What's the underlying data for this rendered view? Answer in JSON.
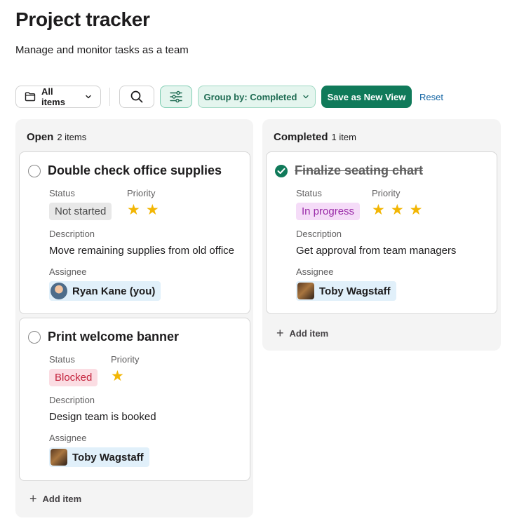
{
  "header": {
    "title": "Project tracker",
    "subtitle": "Manage and monitor tasks as a team"
  },
  "toolbar": {
    "all_items_label": "All items",
    "group_by_label": "Group by: Completed",
    "save_label": "Save as New View",
    "reset_label": "Reset"
  },
  "columns": [
    {
      "name": "Open",
      "count": "2 items",
      "add_label": "Add item",
      "cards": [
        {
          "title": "Double check office supplies",
          "completed": false,
          "status_label": "Status",
          "status": "Not started",
          "priority_label": "Priority",
          "priority": 2,
          "description_label": "Description",
          "description": "Move remaining supplies from old office",
          "assignee_label": "Assignee",
          "assignee": "Ryan Kane (you)"
        },
        {
          "title": "Print welcome banner",
          "completed": false,
          "status_label": "Status",
          "status": "Blocked",
          "priority_label": "Priority",
          "priority": 1,
          "description_label": "Description",
          "description": "Design team is booked",
          "assignee_label": "Assignee",
          "assignee": "Toby Wagstaff"
        }
      ]
    },
    {
      "name": "Completed",
      "count": "1 item",
      "add_label": "Add item",
      "cards": [
        {
          "title": "Finalize seating chart",
          "completed": true,
          "status_label": "Status",
          "status": "In progress",
          "priority_label": "Priority",
          "priority": 3,
          "description_label": "Description",
          "description": "Get approval from team managers",
          "assignee_label": "Assignee",
          "assignee": "Toby Wagstaff"
        }
      ]
    }
  ],
  "colors": {
    "accent": "#107a5a",
    "link": "#1264a3",
    "star": "#f2b604"
  },
  "icons": [
    "folder-icon",
    "chevron-down-icon",
    "search-icon",
    "filter-sliders-icon",
    "check-circle-icon",
    "plus-icon",
    "star-icon"
  ]
}
